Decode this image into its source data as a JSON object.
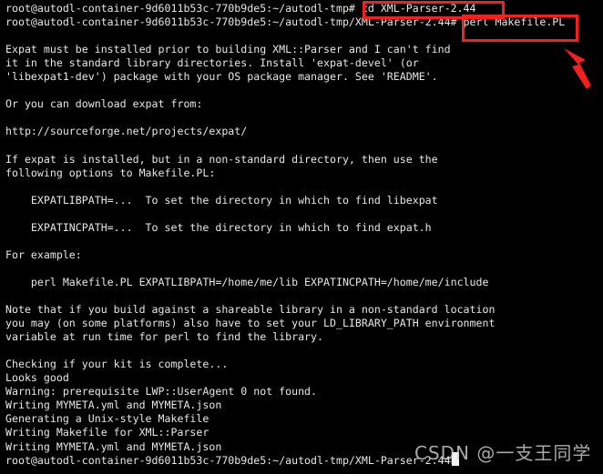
{
  "terminal": {
    "prompt_user_host": "root@autodl-container-9d6011b53c-770b9de5",
    "background_color": "#000000",
    "text_color": "#e6e6e6",
    "lines": [
      "root@autodl-container-9d6011b53c-770b9de5:~/autodl-tmp# cd XML-Parser-2.44",
      "root@autodl-container-9d6011b53c-770b9de5:~/autodl-tmp/XML-Parser-2.44# perl Makefile.PL",
      "",
      "Expat must be installed prior to building XML::Parser and I can't find",
      "it in the standard library directories. Install 'expat-devel' (or",
      "'libexpat1-dev') package with your OS package manager. See 'README'.",
      "",
      "Or you can download expat from:",
      "",
      "http://sourceforge.net/projects/expat/",
      "",
      "If expat is installed, but in a non-standard directory, then use the",
      "following options to Makefile.PL:",
      "",
      "    EXPATLIBPATH=...  To set the directory in which to find libexpat",
      "",
      "    EXPATINCPATH=...  To set the directory in which to find expat.h",
      "",
      "For example:",
      "",
      "    perl Makefile.PL EXPATLIBPATH=/home/me/lib EXPATINCPATH=/home/me/include",
      "",
      "Note that if you build against a shareable library in a non-standard location",
      "you may (on some platforms) also have to set your LD_LIBRARY_PATH environment",
      "variable at run time for perl to find the library.",
      "",
      "Checking if your kit is complete...",
      "Looks good",
      "Warning: prerequisite LWP::UserAgent 0 not found.",
      "Writing MYMETA.yml and MYMETA.json",
      "Generating a Unix-style Makefile",
      "Writing Makefile for XML::Parser",
      "Writing MYMETA.yml and MYMETA.json",
      "root@autodl-container-9d6011b53c-770b9de5:~/autodl-tmp/XML-Parser-2.44#"
    ]
  },
  "annotations": {
    "color": "#f41f1f",
    "box_cd_command": "cd XML-Parser-2.44",
    "box_perl_command": "perl Makefile.PL",
    "arrow_label": "arrow-pointing-to-perl-command"
  },
  "watermark": {
    "text": "CSDN @一支王同学"
  }
}
